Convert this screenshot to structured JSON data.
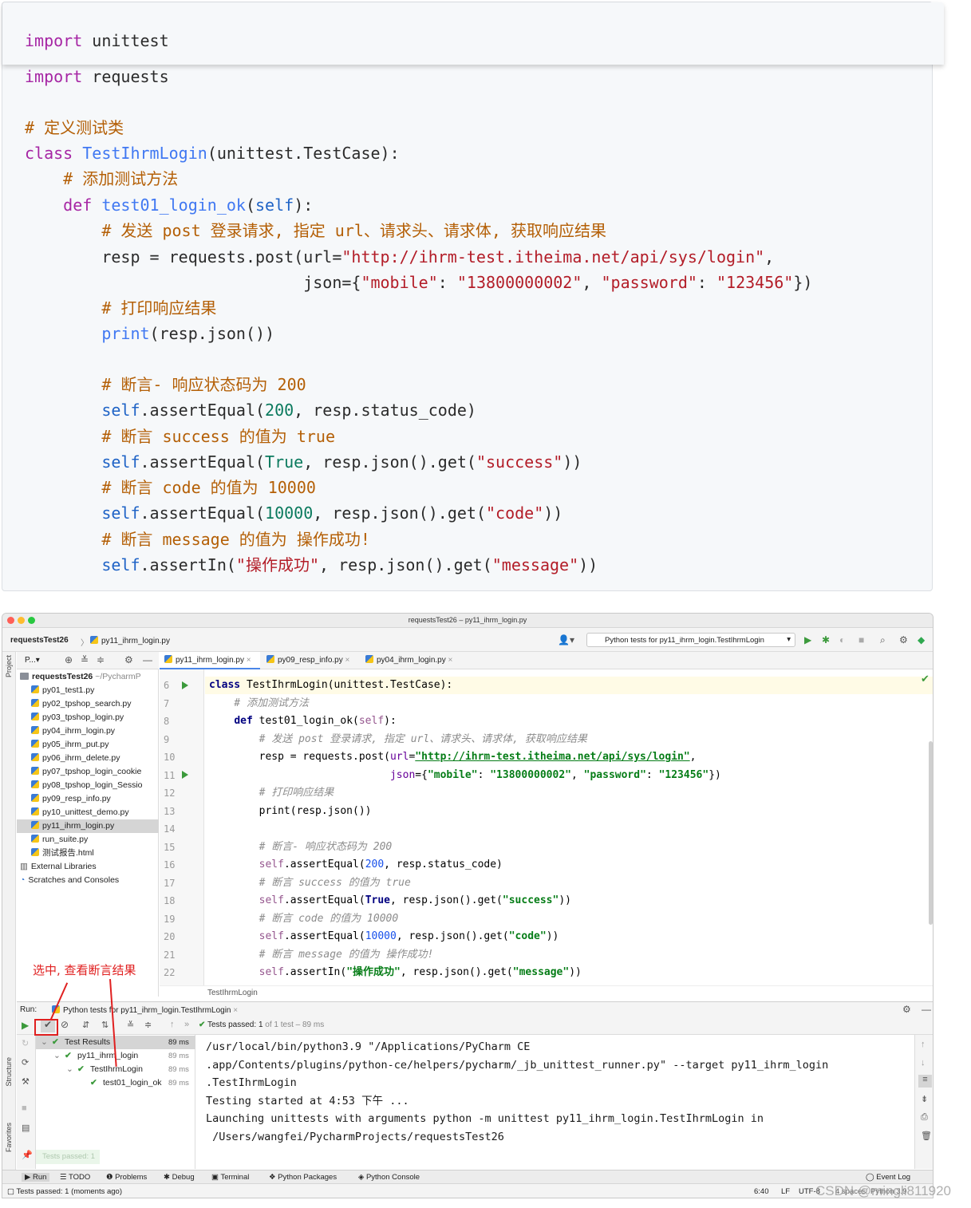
{
  "blog_code": {
    "lines": [
      {
        "segments": [
          {
            "t": "import",
            "c": "kw"
          },
          {
            "t": " unittest",
            "c": "plain"
          }
        ]
      },
      {
        "segments": [
          {
            "t": "import",
            "c": "kw"
          },
          {
            "t": " requests",
            "c": "plain"
          }
        ]
      },
      {
        "segments": [
          {
            "t": "# 定义测试类",
            "c": "cmt"
          }
        ]
      },
      {
        "segments": [
          {
            "t": "class",
            "c": "kw"
          },
          {
            "t": " ",
            "c": "plain"
          },
          {
            "t": "TestIhrmLogin",
            "c": "cls"
          },
          {
            "t": "(unittest.TestCase):",
            "c": "plain"
          }
        ]
      },
      {
        "segments": [
          {
            "t": "    # 添加测试方法",
            "c": "cmt"
          }
        ]
      },
      {
        "segments": [
          {
            "t": "    ",
            "c": "plain"
          },
          {
            "t": "def",
            "c": "kw"
          },
          {
            "t": " ",
            "c": "plain"
          },
          {
            "t": "test01_login_ok",
            "c": "fn"
          },
          {
            "t": "(",
            "c": "plain"
          },
          {
            "t": "self",
            "c": "self"
          },
          {
            "t": "):",
            "c": "plain"
          }
        ]
      },
      {
        "segments": [
          {
            "t": "        # 发送 post 登录请求, 指定 url、请求头、请求体, 获取响应结果",
            "c": "cmt"
          }
        ]
      },
      {
        "segments": [
          {
            "t": "        resp = requests.post(url=",
            "c": "plain"
          },
          {
            "t": "\"http://ihrm-test.itheima.net/api/sys/login\"",
            "c": "str"
          },
          {
            "t": ",",
            "c": "plain"
          }
        ]
      },
      {
        "segments": [
          {
            "t": "                             json={",
            "c": "plain"
          },
          {
            "t": "\"mobile\"",
            "c": "str"
          },
          {
            "t": ": ",
            "c": "plain"
          },
          {
            "t": "\"13800000002\"",
            "c": "str"
          },
          {
            "t": ", ",
            "c": "plain"
          },
          {
            "t": "\"password\"",
            "c": "str"
          },
          {
            "t": ": ",
            "c": "plain"
          },
          {
            "t": "\"123456\"",
            "c": "str"
          },
          {
            "t": "})",
            "c": "plain"
          }
        ]
      },
      {
        "segments": [
          {
            "t": "        # 打印响应结果",
            "c": "cmt"
          }
        ]
      },
      {
        "segments": [
          {
            "t": "        ",
            "c": "plain"
          },
          {
            "t": "print",
            "c": "fn"
          },
          {
            "t": "(resp.json())",
            "c": "plain"
          }
        ]
      },
      {
        "segments": [
          {
            "t": "        # 断言- 响应状态码为 200",
            "c": "cmt"
          }
        ]
      },
      {
        "segments": [
          {
            "t": "        ",
            "c": "plain"
          },
          {
            "t": "self",
            "c": "self"
          },
          {
            "t": ".assertEqual(",
            "c": "plain"
          },
          {
            "t": "200",
            "c": "num"
          },
          {
            "t": ", resp.status_code)",
            "c": "plain"
          }
        ]
      },
      {
        "segments": [
          {
            "t": "        # 断言 success 的值为 true",
            "c": "cmt"
          }
        ]
      },
      {
        "segments": [
          {
            "t": "        ",
            "c": "plain"
          },
          {
            "t": "self",
            "c": "self"
          },
          {
            "t": ".assertEqual(",
            "c": "plain"
          },
          {
            "t": "True",
            "c": "num"
          },
          {
            "t": ", resp.json().get(",
            "c": "plain"
          },
          {
            "t": "\"success\"",
            "c": "str"
          },
          {
            "t": "))",
            "c": "plain"
          }
        ]
      },
      {
        "segments": [
          {
            "t": "        # 断言 code 的值为 10000",
            "c": "cmt"
          }
        ]
      },
      {
        "segments": [
          {
            "t": "        ",
            "c": "plain"
          },
          {
            "t": "self",
            "c": "self"
          },
          {
            "t": ".assertEqual(",
            "c": "plain"
          },
          {
            "t": "10000",
            "c": "num"
          },
          {
            "t": ", resp.json().get(",
            "c": "plain"
          },
          {
            "t": "\"code\"",
            "c": "str"
          },
          {
            "t": "))",
            "c": "plain"
          }
        ]
      },
      {
        "segments": [
          {
            "t": "        # 断言 message 的值为 操作成功!",
            "c": "cmt"
          }
        ]
      },
      {
        "segments": [
          {
            "t": "        ",
            "c": "plain"
          },
          {
            "t": "self",
            "c": "self"
          },
          {
            "t": ".assertIn(",
            "c": "plain"
          },
          {
            "t": "\"操作成功\"",
            "c": "str"
          },
          {
            "t": ", resp.json().get(",
            "c": "plain"
          },
          {
            "t": "\"message\"",
            "c": "str"
          },
          {
            "t": "))",
            "c": "plain"
          }
        ]
      }
    ]
  },
  "ide": {
    "window_title": "requestsTest26 – py11_ihrm_login.py",
    "breadcrumb_project": "requestsTest26",
    "breadcrumb_file": "py11_ihrm_login.py",
    "run_config": "Python tests for py11_ihrm_login.TestIhrmLogin",
    "project_panel_label": "P...",
    "sidebar_labels": {
      "project": "Project",
      "structure": "Structure",
      "favorites": "Favorites"
    },
    "project_root": "requestsTest26",
    "project_root_path": "~/PycharmP",
    "files": [
      "py01_test1.py",
      "py02_tpshop_search.py",
      "py03_tpshop_login.py",
      "py04_ihrm_login.py",
      "py05_ihrm_put.py",
      "py06_ihrm_delete.py",
      "py07_tpshop_login_cookie",
      "py08_tpshop_login_Sessio",
      "py09_resp_info.py",
      "py10_unittest_demo.py",
      "py11_ihrm_login.py",
      "run_suite.py",
      "测试报告.html"
    ],
    "selected_file": "py11_ihrm_login.py",
    "external_libraries": "External Libraries",
    "scratches": "Scratches and Consoles",
    "tabs": [
      "py11_ihrm_login.py",
      "py09_resp_info.py",
      "py04_ihrm_login.py"
    ],
    "line_numbers": [
      "6",
      "7",
      "8",
      "9",
      "10",
      "11",
      "12",
      "13",
      "14",
      "15",
      "16",
      "17",
      "18",
      "19",
      "20",
      "21",
      "22"
    ],
    "editor_lines": [
      [
        {
          "t": "class",
          "c": "e-kw"
        },
        {
          "t": " TestIhrmLogin(unittest.TestCase):",
          "c": ""
        }
      ],
      [
        {
          "t": "    # 添加测试方法",
          "c": "e-cmt"
        }
      ],
      [
        {
          "t": "    ",
          "c": ""
        },
        {
          "t": "def",
          "c": "e-kw"
        },
        {
          "t": " test01_login_ok(",
          "c": ""
        },
        {
          "t": "self",
          "c": "e-self"
        },
        {
          "t": "):",
          "c": ""
        }
      ],
      [
        {
          "t": "        # 发送 post 登录请求, 指定 url、请求头、请求体, 获取响应结果",
          "c": "e-cmt"
        }
      ],
      [
        {
          "t": "        resp = requests.post(",
          "c": ""
        },
        {
          "t": "url",
          "c": "e-kwarg"
        },
        {
          "t": "=",
          "c": ""
        },
        {
          "t": "\"http://ihrm-test.itheima.net/api/sys/login\"",
          "c": "e-url"
        },
        {
          "t": ",",
          "c": ""
        }
      ],
      [
        {
          "t": "                             ",
          "c": ""
        },
        {
          "t": "json",
          "c": "e-kwarg"
        },
        {
          "t": "={",
          "c": ""
        },
        {
          "t": "\"mobile\"",
          "c": "e-str"
        },
        {
          "t": ": ",
          "c": ""
        },
        {
          "t": "\"13800000002\"",
          "c": "e-str"
        },
        {
          "t": ", ",
          "c": ""
        },
        {
          "t": "\"password\"",
          "c": "e-str"
        },
        {
          "t": ": ",
          "c": ""
        },
        {
          "t": "\"123456\"",
          "c": "e-str"
        },
        {
          "t": "})",
          "c": ""
        }
      ],
      [
        {
          "t": "        # 打印响应结果",
          "c": "e-cmt"
        }
      ],
      [
        {
          "t": "        print(resp.json())",
          "c": ""
        }
      ],
      [
        {
          "t": "",
          "c": ""
        }
      ],
      [
        {
          "t": "        # 断言- 响应状态码为 200",
          "c": "e-cmt"
        }
      ],
      [
        {
          "t": "        ",
          "c": ""
        },
        {
          "t": "self",
          "c": "e-self"
        },
        {
          "t": ".assertEqual(",
          "c": ""
        },
        {
          "t": "200",
          "c": "e-num"
        },
        {
          "t": ", resp.status_code)",
          "c": ""
        }
      ],
      [
        {
          "t": "        # 断言 success 的值为 true",
          "c": "e-cmt"
        }
      ],
      [
        {
          "t": "        ",
          "c": ""
        },
        {
          "t": "self",
          "c": "e-self"
        },
        {
          "t": ".assertEqual(",
          "c": ""
        },
        {
          "t": "True",
          "c": "e-true"
        },
        {
          "t": ", resp.json().get(",
          "c": ""
        },
        {
          "t": "\"success\"",
          "c": "e-str"
        },
        {
          "t": "))",
          "c": ""
        }
      ],
      [
        {
          "t": "        # 断言 code 的值为 10000",
          "c": "e-cmt"
        }
      ],
      [
        {
          "t": "        ",
          "c": ""
        },
        {
          "t": "self",
          "c": "e-self"
        },
        {
          "t": ".assertEqual(",
          "c": ""
        },
        {
          "t": "10000",
          "c": "e-num"
        },
        {
          "t": ", resp.json().get(",
          "c": ""
        },
        {
          "t": "\"code\"",
          "c": "e-str"
        },
        {
          "t": "))",
          "c": ""
        }
      ],
      [
        {
          "t": "        # 断言 message 的值为 操作成功!",
          "c": "e-cmt"
        }
      ],
      [
        {
          "t": "        ",
          "c": ""
        },
        {
          "t": "self",
          "c": "e-self"
        },
        {
          "t": ".assertIn(",
          "c": ""
        },
        {
          "t": "\"操作成功\"",
          "c": "e-str"
        },
        {
          "t": ", resp.json().get(",
          "c": ""
        },
        {
          "t": "\"message\"",
          "c": "e-str"
        },
        {
          "t": "))",
          "c": ""
        }
      ]
    ],
    "editor_breadcrumb": "TestIhrmLogin",
    "annotation": "选中, 查看断言结果",
    "run_label": "Run:",
    "run_tab": "Python tests for py11_ihrm_login.TestIhrmLogin",
    "tests_passed_bold": "Tests passed:",
    "tests_passed_count": "1",
    "tests_passed_rest": "of 1 test – 89 ms",
    "test_tree": [
      {
        "label": "Test Results",
        "time": "89 ms"
      },
      {
        "label": "py11_ihrm_login",
        "time": "89 ms"
      },
      {
        "label": "TestIhrmLogin",
        "time": "89 ms"
      },
      {
        "label": "test01_login_ok",
        "time": "89 ms"
      }
    ],
    "toast": "Tests passed: 1",
    "console_lines": [
      "/usr/local/bin/python3.9 \"/Applications/PyCharm CE",
      ".app/Contents/plugins/python-ce/helpers/pycharm/_jb_unittest_runner.py\" --target py11_ihrm_login",
      ".TestIhrmLogin",
      "Testing started at 4:53 下午 ...",
      "Launching unittests with arguments python -m unittest py11_ihrm_login.TestIhrmLogin in",
      " /Users/wangfei/PycharmProjects/requestsTest26"
    ],
    "bottom_tabs": [
      "Run",
      "TODO",
      "Problems",
      "Debug",
      "Terminal",
      "Python Packages",
      "Python Console"
    ],
    "event_log": "Event Log",
    "status_left": "Tests passed: 1 (moments ago)",
    "status_position": "6:40",
    "status_lf": "LF",
    "status_encoding": "UTF-8",
    "status_spaces": "4 spaces",
    "status_interpreter": "Python 3.9"
  },
  "watermark": "CSDN @mingli811920"
}
